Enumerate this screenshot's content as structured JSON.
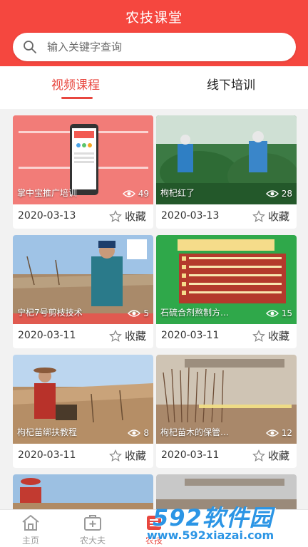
{
  "header": {
    "title": "农技课堂"
  },
  "search": {
    "placeholder": "输入关键字查询",
    "value": ""
  },
  "tabs": [
    {
      "label": "视频课程",
      "active": true
    },
    {
      "label": "线下培训",
      "active": false
    }
  ],
  "cards": [
    {
      "caption": "掌中宝推广培训",
      "views": "49",
      "date": "2020-03-13",
      "fav_label": "收藏"
    },
    {
      "caption": "枸杞红了",
      "views": "28",
      "date": "2020-03-13",
      "fav_label": "收藏"
    },
    {
      "caption": "宁杞7号剪枝技术",
      "views": "5",
      "date": "2020-03-11",
      "fav_label": "收藏"
    },
    {
      "caption": "石硫合剂熬制方…",
      "views": "15",
      "date": "2020-03-11",
      "fav_label": "收藏"
    },
    {
      "caption": "枸杞苗绑扶教程",
      "views": "8",
      "date": "2020-03-11",
      "fav_label": "收藏"
    },
    {
      "caption": "枸杞苗木的保管…",
      "views": "12",
      "date": "2020-03-11",
      "fav_label": "收藏"
    }
  ],
  "nav": [
    {
      "label": "主页",
      "icon": "home-icon"
    },
    {
      "label": "农大夫",
      "icon": "medical-kit-icon"
    },
    {
      "label": "农技",
      "icon": "class-icon",
      "active": true
    }
  ],
  "watermark": {
    "brand": "592软件园",
    "url": "www.592xiazai.com"
  },
  "colors": {
    "accent": "#f5473f",
    "active_tab": "#e8473f",
    "watermark": "#2b95e5"
  }
}
